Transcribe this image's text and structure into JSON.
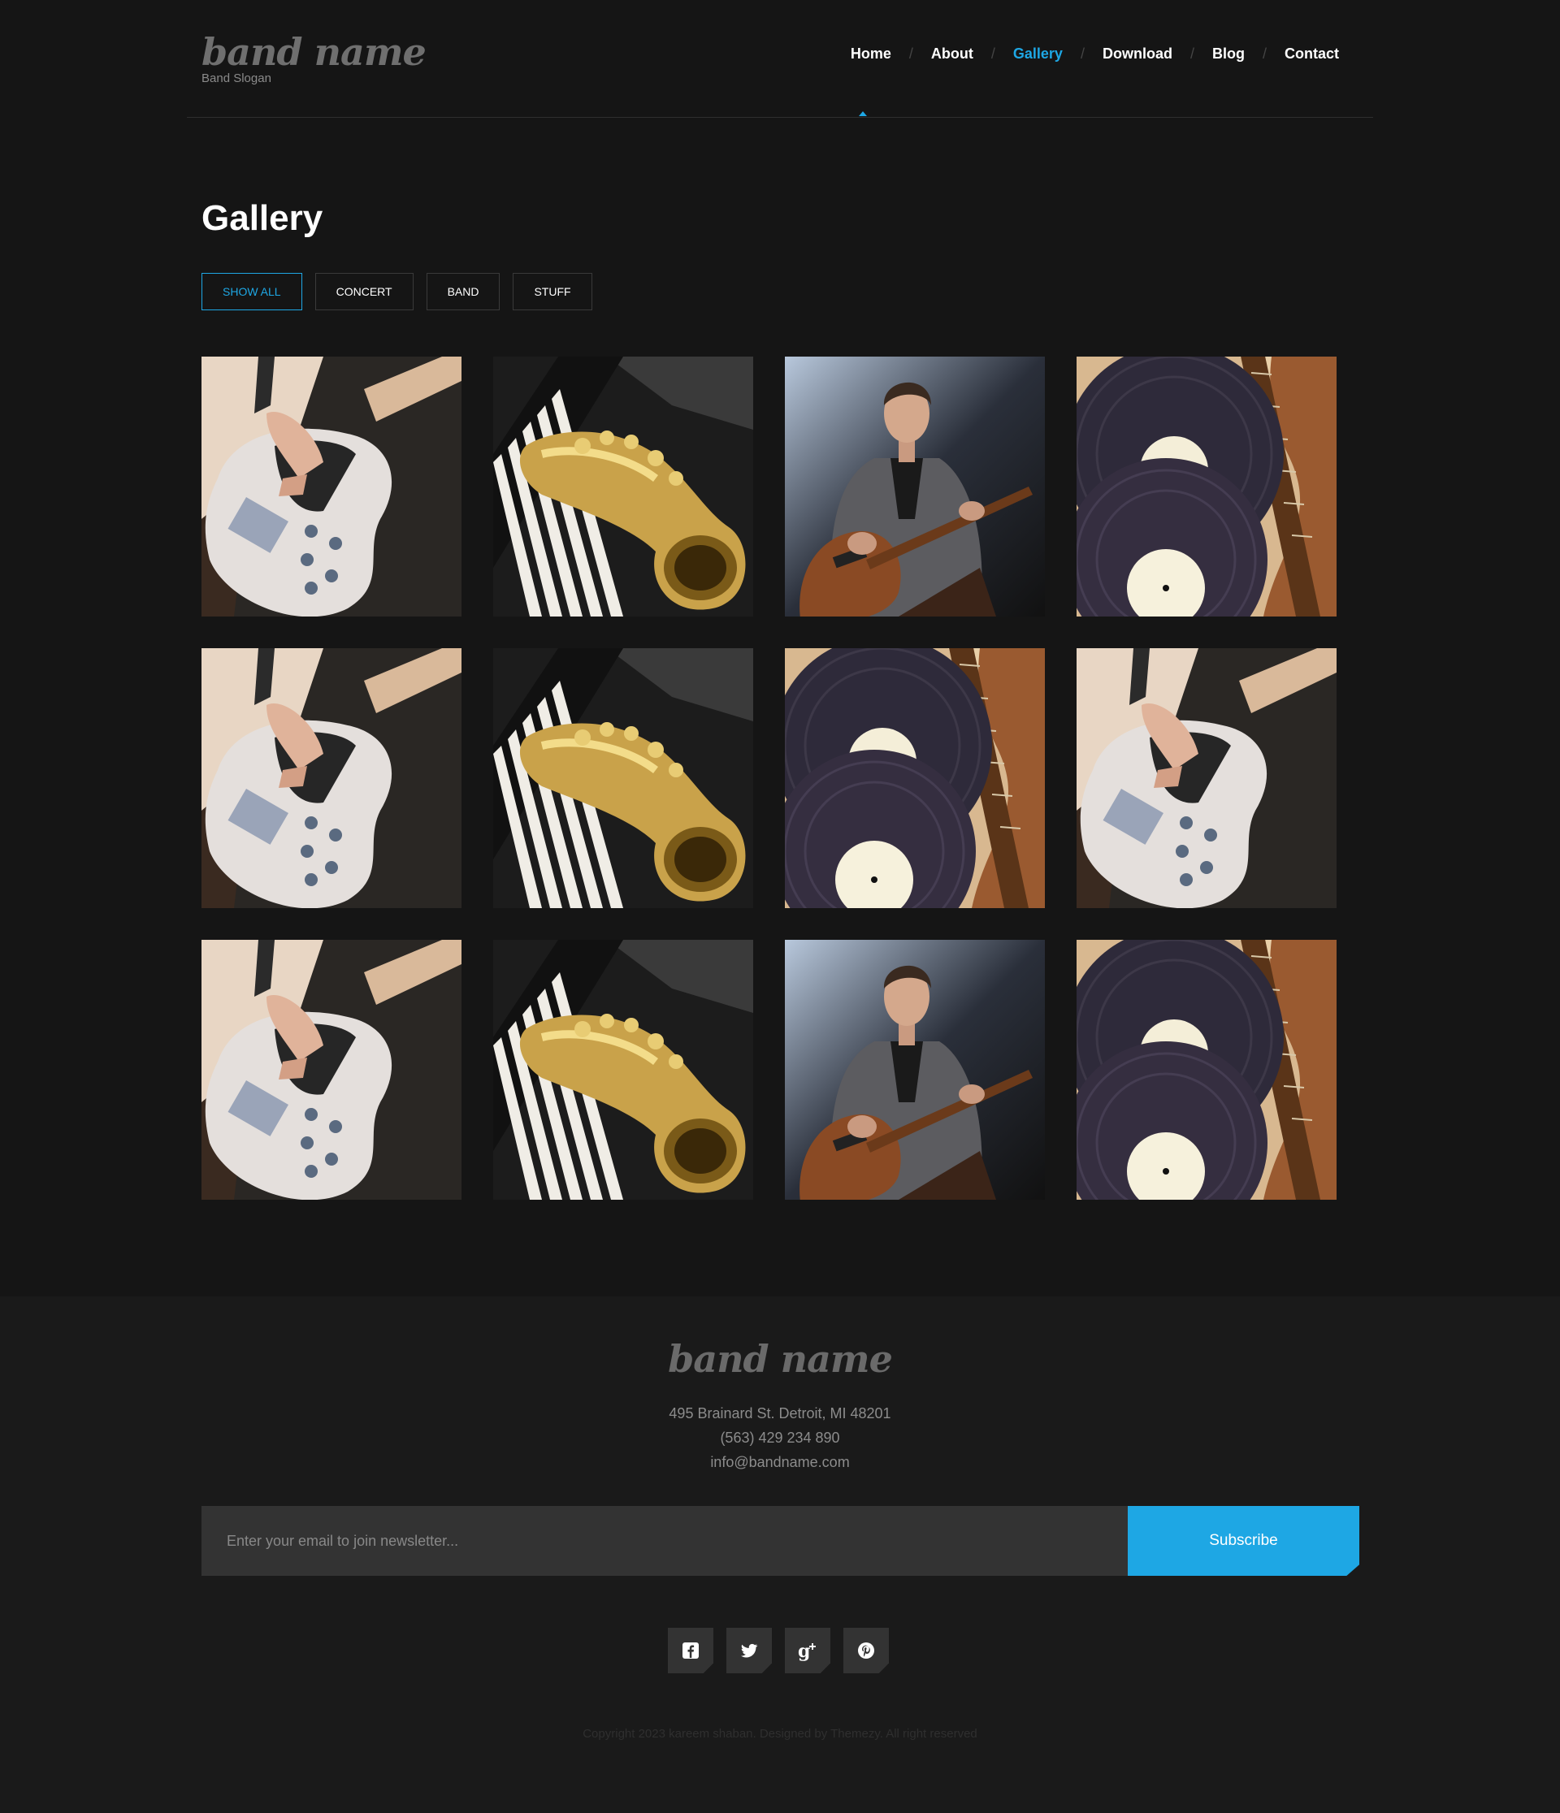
{
  "header": {
    "logo": "band name",
    "slogan": "Band Slogan",
    "nav": [
      {
        "label": "Home",
        "active": false
      },
      {
        "label": "About",
        "active": false
      },
      {
        "label": "Gallery",
        "active": true
      },
      {
        "label": "Download",
        "active": false
      },
      {
        "label": "Blog",
        "active": false
      },
      {
        "label": "Contact",
        "active": false
      }
    ],
    "nav_separator": "/"
  },
  "gallery": {
    "title": "Gallery",
    "filters": [
      "SHOW ALL",
      "CONCERT",
      "BAND",
      "STUFF"
    ],
    "active_filter": "SHOW ALL",
    "images": [
      "bass-guitar-photo",
      "saxophone-piano-photo",
      "guitarist-photo",
      "vinyl-records-photo",
      "bass-guitar-photo",
      "saxophone-piano-photo",
      "vinyl-records-photo",
      "bass-guitar-photo",
      "bass-guitar-photo",
      "saxophone-piano-photo",
      "guitarist-photo",
      "vinyl-records-photo"
    ]
  },
  "footer": {
    "logo": "band name",
    "address": "495 Brainard St. Detroit, MI 48201",
    "phone": "(563) 429 234 890",
    "email": "info@bandname.com",
    "newsletter_placeholder": "Enter your email to join newsletter...",
    "subscribe_label": "Subscribe",
    "social": [
      "facebook-icon",
      "twitter-icon",
      "google-plus-icon",
      "pinterest-icon"
    ],
    "copyright": "Copyright 2023 kareem shaban. Designed by Themezy. All right reserved"
  },
  "colors": {
    "accent": "#1ea7e4",
    "background": "#151515",
    "footer_bg": "#1a1a1a"
  }
}
